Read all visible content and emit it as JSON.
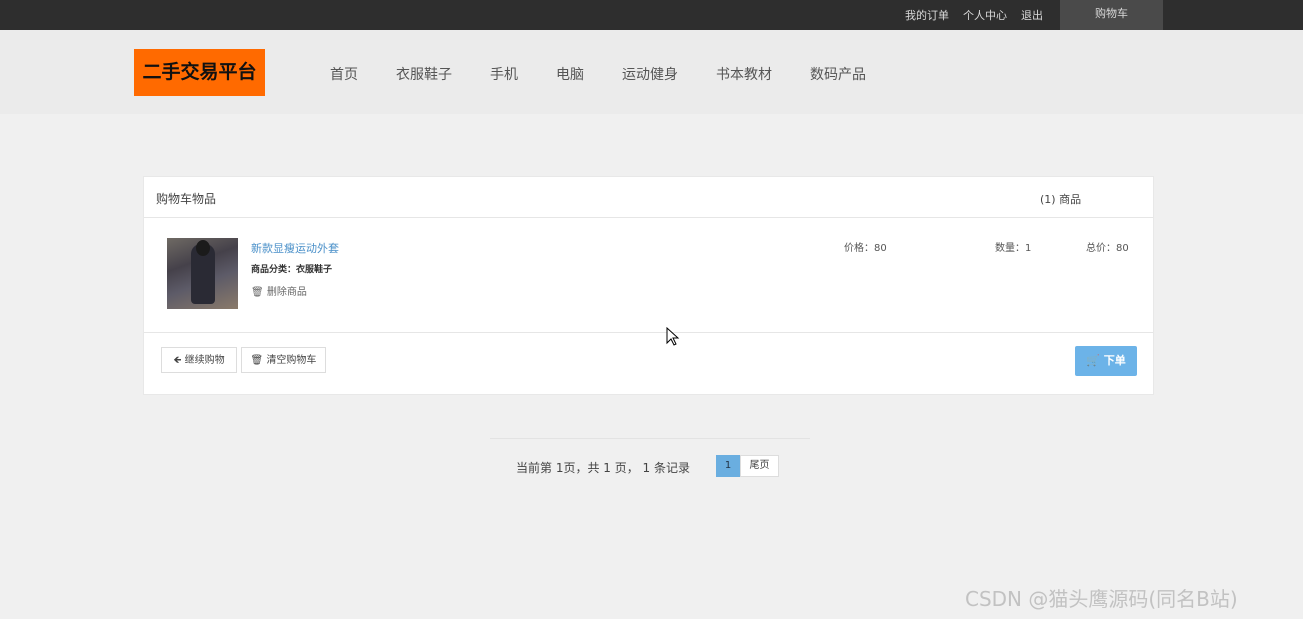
{
  "topbar": {
    "links": [
      "我的订单",
      "个人中心",
      "退出"
    ],
    "cart": "购物车"
  },
  "header": {
    "logo": "二手交易平台",
    "nav": [
      "首页",
      "衣服鞋子",
      "手机",
      "电脑",
      "运动健身",
      "书本教材",
      "数码产品"
    ]
  },
  "cart": {
    "title": "购物车物品",
    "count": "(1) 商品",
    "items": [
      {
        "name": "新款显瘦运动外套",
        "category": "商品分类：衣服鞋子",
        "delete": "删除商品",
        "price": "价格：80",
        "quantity": "数量：1",
        "total": "总价：80"
      }
    ],
    "continue": "继续购物",
    "clear": "清空购物车",
    "order": "下单"
  },
  "pagination": {
    "summary": "当前第 1页，共 1 页， 1 条记录",
    "current": "1",
    "last": "尾页"
  },
  "watermark": "CSDN @猫头鹰源码(同名B站)",
  "colors": {
    "logo": "#ff6a00",
    "accent": "#6cb3e8",
    "topbar": "#2e2e2e"
  }
}
